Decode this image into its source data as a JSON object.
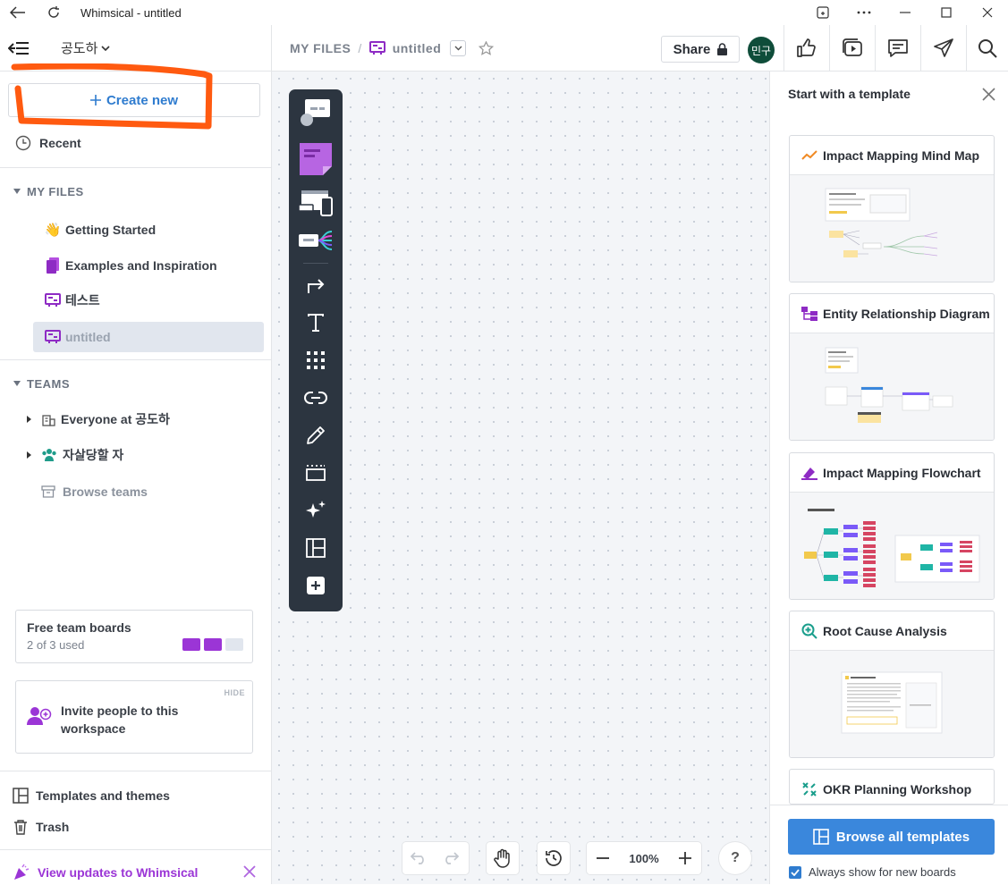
{
  "window": {
    "title": "Whimsical - untitled"
  },
  "sidebar": {
    "workspace_name": "공도하",
    "create_new_label": "Create new",
    "recent_label": "Recent",
    "my_files_heading": "MY FILES",
    "files": [
      {
        "label": "Getting Started",
        "icon": "wave-emoji-icon"
      },
      {
        "label": "Examples and Inspiration",
        "icon": "book-icon"
      },
      {
        "label": "테스트",
        "icon": "board-icon"
      },
      {
        "label": "untitled",
        "icon": "board-icon",
        "selected": true
      }
    ],
    "teams_heading": "TEAMS",
    "teams": [
      {
        "label": "Everyone at 공도하",
        "icon": "building-icon"
      },
      {
        "label": "자살당할 자",
        "icon": "team-icon"
      }
    ],
    "browse_teams_label": "Browse teams",
    "free_boards": {
      "title": "Free team boards",
      "used_text": "2 of 3 used",
      "used": 2,
      "total": 3
    },
    "invite": {
      "hide_label": "HIDE",
      "text": "Invite people to this workspace"
    },
    "templates_label": "Templates and themes",
    "trash_label": "Trash",
    "updates_label": "View updates to Whimsical"
  },
  "header": {
    "breadcrumb_root": "MY FILES",
    "breadcrumb_sep": "/",
    "file_name": "untitled",
    "share_label": "Share",
    "avatar_initials": "민구"
  },
  "canvas": {
    "zoom": "100%",
    "help": "?"
  },
  "templates_panel": {
    "title": "Start with a template",
    "templates": [
      {
        "name": "Impact Mapping Mind Map",
        "icon": "trend-icon"
      },
      {
        "name": "Entity Relationship Diagram",
        "icon": "erd-icon"
      },
      {
        "name": "Impact Mapping Flowchart",
        "icon": "flowchart-icon"
      },
      {
        "name": "Root Cause Analysis",
        "icon": "magnify-plus-icon"
      },
      {
        "name": "OKR Planning Workshop",
        "icon": "okr-icon"
      }
    ],
    "browse_label": "Browse all templates",
    "always_show_label": "Always show for new boards"
  },
  "colors": {
    "accent_blue": "#2f7ccf",
    "button_blue": "#3a87dc",
    "toolbar_dark": "#2c3540",
    "purple": "#9b35d6",
    "annotation_orange": "#ff5a10",
    "avatar_green": "#0f4d3a"
  }
}
